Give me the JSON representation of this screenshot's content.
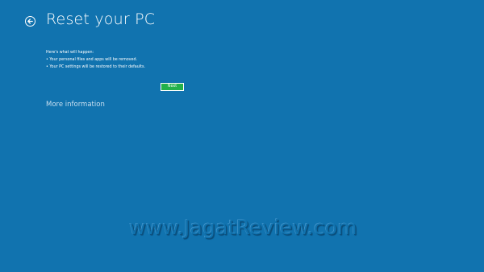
{
  "header": {
    "title": "Reset your PC",
    "back_icon": "arrow-left-circle-icon"
  },
  "content": {
    "intro": "Here's what will happen:",
    "bullets": [
      "• Your personal files and apps will be removed.",
      "• Your PC settings will be restored to their defaults."
    ],
    "next_label": "Next",
    "more_info": "More information"
  },
  "watermark": {
    "text": "www.JagatReview.com"
  },
  "colors": {
    "background": "#1173af",
    "button": "#23b14a",
    "text": "#ffffff"
  }
}
